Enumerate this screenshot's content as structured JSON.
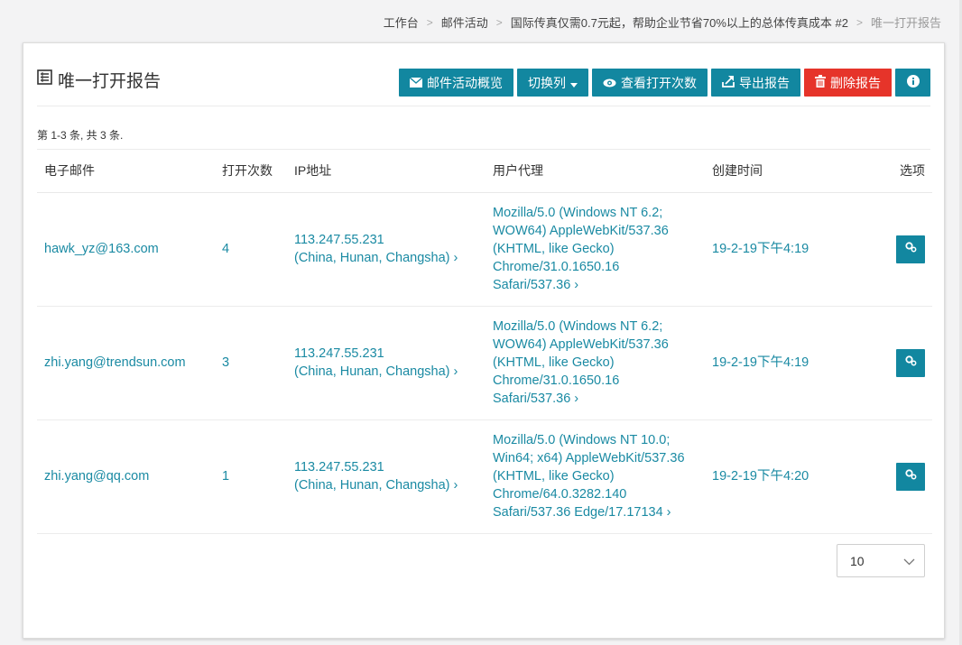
{
  "breadcrumb": [
    {
      "label": "工作台"
    },
    {
      "label": "邮件活动"
    },
    {
      "label": "国际传真仅需0.7元起，帮助企业节省70%以上的总体传真成本 #2"
    },
    {
      "label": "唯一打开报告"
    }
  ],
  "panel": {
    "title": "唯一打开报告",
    "buttons": {
      "overview": "邮件活动概览",
      "switch_columns": "切换列",
      "view_opens": "查看打开次数",
      "export": "导出报告",
      "delete": "删除报告"
    },
    "summary": "第 1-3 条, 共 3 条."
  },
  "table": {
    "headers": {
      "email": "电子邮件",
      "opens": "打开次数",
      "ip": "IP地址",
      "ua": "用户代理",
      "created": "创建时间",
      "options": "选项"
    },
    "rows": [
      {
        "email": "hawk_yz@163.com",
        "opens": "4",
        "ip_lines": [
          "113.247.55.231",
          "(China, Hunan, Changsha) ›"
        ],
        "ua_lines": [
          "Mozilla/5.0 (Windows NT 6.2;",
          "WOW64) AppleWebKit/537.36",
          "(KHTML, like Gecko)",
          "Chrome/31.0.1650.16",
          "Safari/537.36 ›"
        ],
        "created": "19-2-19下午4:19"
      },
      {
        "email": "zhi.yang@trendsun.com",
        "opens": "3",
        "ip_lines": [
          "113.247.55.231",
          "(China, Hunan, Changsha) ›"
        ],
        "ua_lines": [
          "Mozilla/5.0 (Windows NT 6.2;",
          "WOW64) AppleWebKit/537.36",
          "(KHTML, like Gecko)",
          "Chrome/31.0.1650.16",
          "Safari/537.36 ›"
        ],
        "created": "19-2-19下午4:19"
      },
      {
        "email": "zhi.yang@qq.com",
        "opens": "1",
        "ip_lines": [
          "113.247.55.231",
          "(China, Hunan, Changsha) ›"
        ],
        "ua_lines": [
          "Mozilla/5.0 (Windows NT 10.0;",
          "Win64; x64) AppleWebKit/537.36",
          "(KHTML, like Gecko)",
          "Chrome/64.0.3282.140",
          "Safari/537.36 Edge/17.17134 ›"
        ],
        "created": "19-2-19下午4:20"
      }
    ]
  },
  "page_size": {
    "selected": "10"
  },
  "colors": {
    "accent": "#1287a0",
    "danger": "#e6342a",
    "link": "#1a8aa3"
  }
}
